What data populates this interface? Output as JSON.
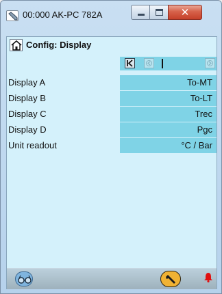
{
  "window": {
    "title": "00:000 AK-PC 782A"
  },
  "page": {
    "title": "Config: Display"
  },
  "rows": [
    {
      "label": "Display A",
      "value": "To-MT"
    },
    {
      "label": "Display B",
      "value": "To-LT"
    },
    {
      "label": "Display C",
      "value": "Trec"
    },
    {
      "label": "Display D",
      "value": "Pgc"
    },
    {
      "label": "Unit readout",
      "value": "°C / Bar"
    }
  ],
  "icons": {
    "app": "wrench-app-icon",
    "home": "home-icon",
    "nav_first": "first-page-icon",
    "nav_prev": "prev-page-icon",
    "nav_next": "next-page-icon",
    "glasses": "glasses-icon",
    "tool": "wrench-icon",
    "alarm": "alarm-bell-icon"
  },
  "colors": {
    "client_bg": "#d4f1fb",
    "value_bg": "#7fd3e6",
    "close_button": "#c5402a",
    "tool_button": "#f0b233",
    "alarm": "#e01010"
  }
}
